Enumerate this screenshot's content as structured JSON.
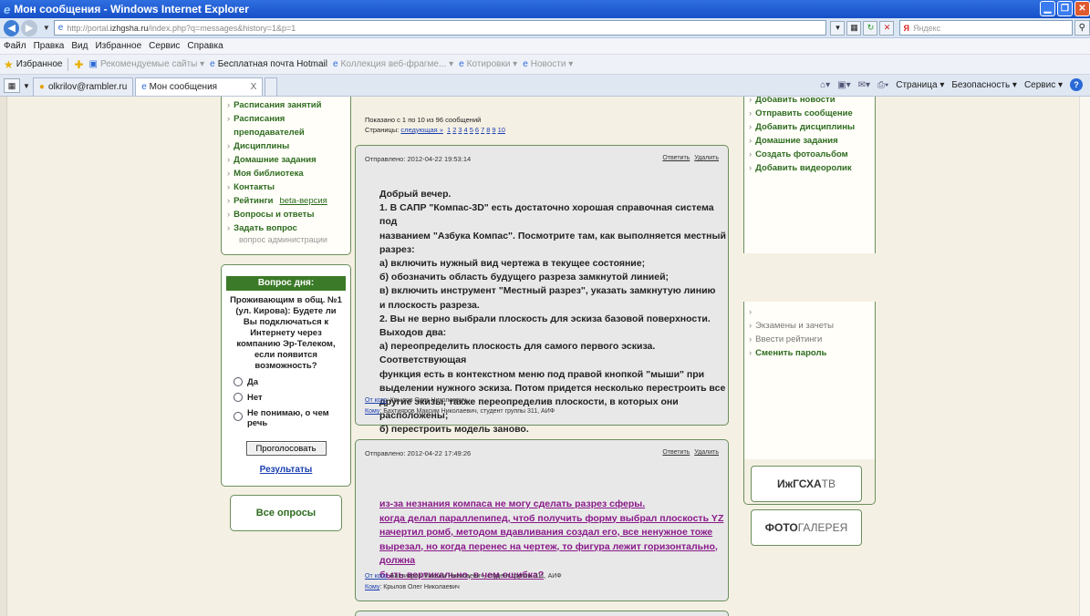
{
  "window": {
    "title": "Мон сообщения - Windows Internet Explorer"
  },
  "address": {
    "url_prefix": "http://portal.",
    "url_domain": "izhgsha.ru",
    "url_suffix": "/index.php?q=messages&history=1&p=1",
    "search_placeholder": "Яндекс"
  },
  "menu": [
    "Файл",
    "Правка",
    "Вид",
    "Избранное",
    "Сервис",
    "Справка"
  ],
  "favorites": {
    "label": "Избранное",
    "items": [
      {
        "label": "Рекомендуемые сайты ▾",
        "dim": true
      },
      {
        "label": "Бесплатная почта Hotmail",
        "dim": false
      },
      {
        "label": "Коллекция веб-фрагме... ▾",
        "dim": true
      },
      {
        "label": "Котировки ▾",
        "dim": true
      },
      {
        "label": "Новости ▾",
        "dim": true
      }
    ]
  },
  "tabs": {
    "tab1": "olkrilov@rambler.ru",
    "tab2": "Мон сообщения",
    "close": "X"
  },
  "commandbar": {
    "page": "Страница ▾",
    "security": "Безопасность ▾",
    "service": "Сервис ▾"
  },
  "leftmenu": {
    "items": [
      "Расписания занятий",
      "Расписания преподавателей",
      "Дисциплины",
      "Домашние задания",
      "Моя библиотека",
      "Контакты",
      "Рейтинги",
      "Вопросы и ответы",
      "Задать вопрос"
    ],
    "beta": "beta-версия",
    "ask_sub": "вопрос администрации"
  },
  "poll": {
    "heading": "Вопрос дня:",
    "question": "Проживающим в общ. №1 (ул. Кирова): Будете ли Вы подключаться к Интернету через компанию Эр-Телеком, если появится возможность?",
    "options": [
      "Да",
      "Нет",
      "Не понимаю, о чем речь"
    ],
    "vote": "Проголосовать",
    "results": "Результаты",
    "all": "Все опросы"
  },
  "paging": {
    "shown": "Показано с 1 по 10 из 96 сообщений",
    "pages_label": "Страницы:",
    "next": "следующая »",
    "pages": [
      "1",
      "2",
      "3",
      "4",
      "5",
      "6",
      "7",
      "8",
      "9",
      "10"
    ]
  },
  "messages": [
    {
      "sent": "Отправлено: 2012-04-22 19:53:14",
      "reply": "Ответить",
      "delete": "Удалить",
      "lines": [
        "Добрый вечер.",
        "1. В САПР \"Компас-3D\" есть достаточно хорошая справочная система под",
        "названием \"Азбука Компас\". Посмотрите там, как выполняется местный",
        "разрез:",
        "а) включить нужный вид чертежа в текущее состояние;",
        "б) обозначить область будущего разреза замкнутой линией;",
        "в) включить инструмент \"Местный разрез\", указать замкнутую линию",
        "и плоскость разреза.",
        "2. Вы не верно выбрали плоскость для эскиза базовой поверхности.",
        "Выходов два:",
        "а) переопределить плоскость для самого первого эскиза. Соответствующая",
        "функция есть в контекстном меню под правой кнопкой \"мыши\" при",
        "выделении нужного эскиза. Потом придется несколько перестроить все",
        "другие экизы, также переопределив плоскости, в которых они расположены;",
        "б) перестроить модель заново."
      ],
      "from_label": "От кого",
      "from": ": Крылов Олег Николаевич",
      "to_label": "Кому",
      "to": ": Бахтияров Максим Николаевич, студент группы 311, АИФ"
    },
    {
      "sent": "Отправлено: 2012-04-22 17:49:26",
      "reply": "Ответить",
      "delete": "Удалить",
      "lines": [
        "из-за незнания компаса не могу сделать разрез сферы.",
        "когда делал параллепипед, чтоб получить форму выбрал плоскость YZ",
        "начертил ромб, методом вдавливания создал его, все ненужное тоже",
        "вырезал, но когда перенес на чертеж, то фигура лежит горизонтально, должна",
        "быть вертикально, в чем ошибка?"
      ],
      "from_label": "От кого",
      "from": ": Бахтияров Максим Николаевич, студент группы 311, АИФ",
      "to_label": "Кому",
      "to": ": Крылов Олег Николаевич"
    }
  ],
  "rightmenu1": [
    "Добавить новости",
    "Отправить сообщение",
    "Добавить дисциплины",
    "Домашние задания",
    "Создать фотоальбом",
    "Добавить видеоролик"
  ],
  "rightmenu2": [
    "Экзамены и зачеты",
    "Ввести рейтинги",
    "Сменить пароль"
  ],
  "banners": {
    "tv_bold": "ИжГСХА",
    "tv_light": "ТВ",
    "photo_bold": "ФОТО",
    "photo_light": "ГАЛЕРЕЯ"
  }
}
